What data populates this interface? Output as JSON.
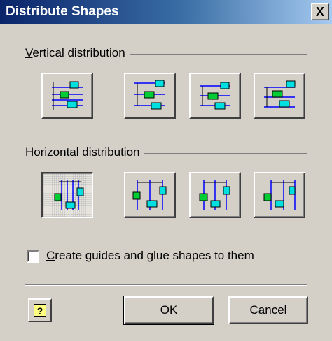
{
  "window": {
    "title": "Distribute Shapes",
    "close_glyph": "X"
  },
  "vertical": {
    "label": "Vertical distribution",
    "mnemonic": "V",
    "label_rest": "ertical distribution",
    "options": [
      "distribute-vertical-spacing",
      "distribute-vertical-top",
      "distribute-vertical-center",
      "distribute-vertical-bottom"
    ]
  },
  "horizontal": {
    "label": "Horizontal distribution",
    "mnemonic": "H",
    "label_rest": "orizontal distribution",
    "selected_index": 0,
    "options": [
      "distribute-horizontal-spacing",
      "distribute-horizontal-left",
      "distribute-horizontal-center",
      "distribute-horizontal-right"
    ]
  },
  "guides": {
    "label": "Create guides and glue shapes to them",
    "mnemonic": "C",
    "label_rest": "reate guides and glue shapes to them",
    "checked": false
  },
  "buttons": {
    "help_glyph": "?",
    "ok": "OK",
    "cancel": "Cancel"
  },
  "colors": {
    "line": "#0000ff",
    "green": "#00cc33",
    "cyan": "#00e0e0"
  }
}
